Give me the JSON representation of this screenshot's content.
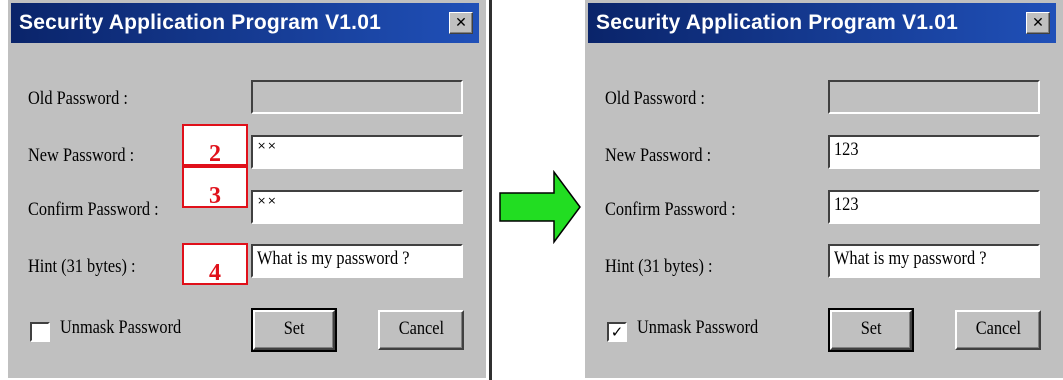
{
  "dialogs": [
    {
      "title": "Security Application Program V1.01",
      "close_glyph": "✕",
      "old_password_label": "Old Password :",
      "new_password_label": "New Password :",
      "confirm_password_label": "Confirm Password :",
      "hint_label": "Hint (31 bytes) :",
      "old_password_value": "",
      "new_password_value": "××",
      "confirm_password_value": "××",
      "hint_value": "What is my password ?",
      "unmask_label": "Unmask Password",
      "unmask_checked": false,
      "unmask_mark": "",
      "set_label": "Set",
      "cancel_label": "Cancel"
    },
    {
      "title": "Security Application Program V1.01",
      "close_glyph": "✕",
      "old_password_label": "Old Password :",
      "new_password_label": "New Password :",
      "confirm_password_label": "Confirm Password :",
      "hint_label": "Hint (31 bytes) :",
      "old_password_value": "",
      "new_password_value": "123",
      "confirm_password_value": "123",
      "hint_value": "What is my password ?",
      "unmask_label": "Unmask Password",
      "unmask_checked": true,
      "unmask_mark": "✓",
      "set_label": "Set",
      "cancel_label": "Cancel"
    }
  ],
  "annotations": [
    "2",
    "3",
    "4"
  ],
  "arrow": {
    "icon": "right-arrow-icon",
    "color": "#22dd22"
  }
}
